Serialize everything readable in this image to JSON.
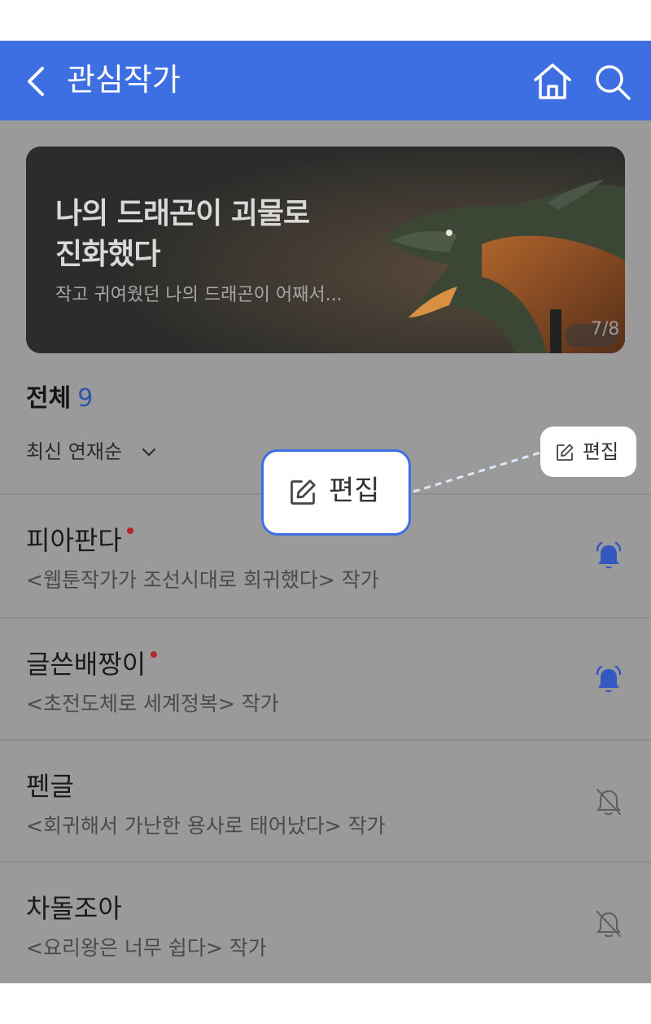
{
  "header": {
    "title": "관심작가",
    "icons": [
      "back-arrow-icon",
      "home-icon",
      "search-icon"
    ]
  },
  "banner": {
    "title_line1": "나의 드래곤이 괴물로",
    "title_line2": "진화했다",
    "description": "작고 귀여웠던 나의 드래곤이 어째서...",
    "counter": "7/8"
  },
  "summary": {
    "label": "전체",
    "count": "9"
  },
  "sort": {
    "label": "최신 연재순"
  },
  "edit": {
    "label": "편집"
  },
  "authors": [
    {
      "name": "피아판다",
      "desc": "<웹툰작가가 조선시대로 회귀했다> 작가",
      "new": true,
      "alarm": "on"
    },
    {
      "name": "글쓴배짱이",
      "desc": "<초전도체로 세계정복> 작가",
      "new": true,
      "alarm": "on"
    },
    {
      "name": "펜글",
      "desc": "<회귀해서 가난한 용사로 태어났다> 작가",
      "new": false,
      "alarm": "off"
    },
    {
      "name": "차돌조아",
      "desc": "<요리왕은 너무 쉽다> 작가",
      "new": false,
      "alarm": "off"
    }
  ],
  "colors": {
    "header_bg": "#3d6fe3",
    "overlay_bg": "#9a9a9a",
    "count": "#2f55b0",
    "alarm_on": "#3358c0",
    "new_dot": "#b3272a"
  }
}
